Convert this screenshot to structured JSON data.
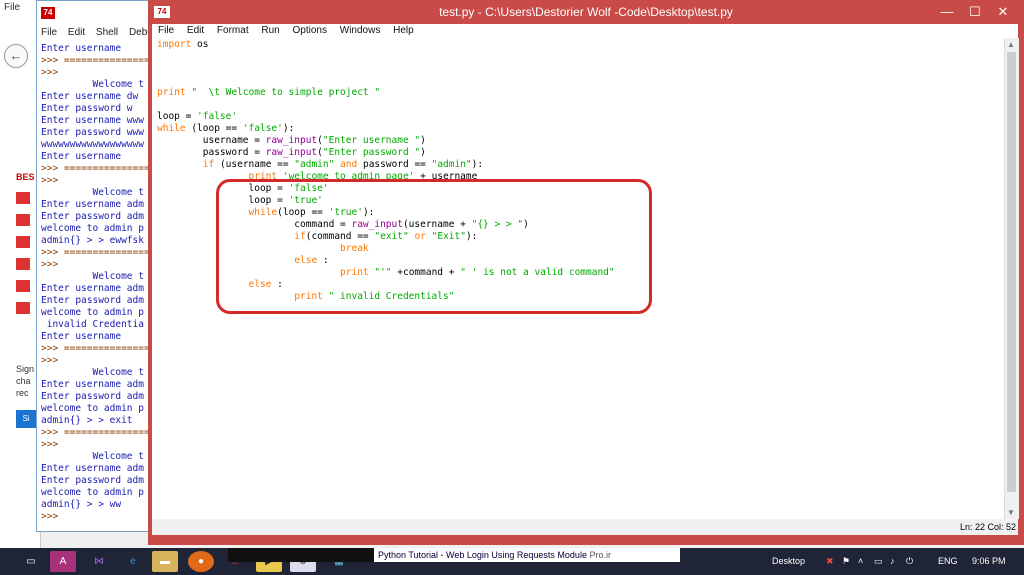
{
  "browser": {
    "menu_label": "File",
    "side_labels": [
      "BES",
      "Sign",
      "cha",
      "rec"
    ],
    "blue_button": "Si"
  },
  "shell": {
    "menu": [
      "File",
      "Edit",
      "Shell",
      "Debug"
    ],
    "lines": [
      {
        "t": "o",
        "text": "Enter username"
      },
      {
        "t": "p",
        "text": ">>> ================"
      },
      {
        "t": "p",
        "text": ">>>"
      },
      {
        "t": "o",
        "text": "         Welcome t"
      },
      {
        "t": "o",
        "text": "Enter username dw"
      },
      {
        "t": "o",
        "text": "Enter password w"
      },
      {
        "t": "o",
        "text": "Enter username www"
      },
      {
        "t": "o",
        "text": "Enter password www"
      },
      {
        "t": "o",
        "text": "wwwwwwwwwwwwwwwwww"
      },
      {
        "t": "o",
        "text": "Enter username"
      },
      {
        "t": "p",
        "text": ">>> ================"
      },
      {
        "t": "p",
        "text": ">>>"
      },
      {
        "t": "o",
        "text": "         Welcome t"
      },
      {
        "t": "o",
        "text": "Enter username adm"
      },
      {
        "t": "o",
        "text": "Enter password adm"
      },
      {
        "t": "o",
        "text": "welcome to admin p"
      },
      {
        "t": "o",
        "text": "admin{} > > ewwfsk"
      },
      {
        "t": "p",
        "text": ">>> ================"
      },
      {
        "t": "p",
        "text": ">>>"
      },
      {
        "t": "o",
        "text": "         Welcome t"
      },
      {
        "t": "o",
        "text": "Enter username adm"
      },
      {
        "t": "o",
        "text": "Enter password adm"
      },
      {
        "t": "o",
        "text": "welcome to admin p"
      },
      {
        "t": "o",
        "text": " invalid Credentia"
      },
      {
        "t": "o",
        "text": "Enter username"
      },
      {
        "t": "p",
        "text": ">>> ================"
      },
      {
        "t": "p",
        "text": ">>>"
      },
      {
        "t": "o",
        "text": "         Welcome t"
      },
      {
        "t": "o",
        "text": "Enter username adm"
      },
      {
        "t": "o",
        "text": "Enter password adm"
      },
      {
        "t": "o",
        "text": "welcome to admin p"
      },
      {
        "t": "o",
        "text": "admin{} > > exit"
      },
      {
        "t": "p",
        "text": ">>> ================"
      },
      {
        "t": "p",
        "text": ">>>"
      },
      {
        "t": "o",
        "text": "         Welcome t"
      },
      {
        "t": "o",
        "text": "Enter username adm"
      },
      {
        "t": "o",
        "text": "Enter password adm"
      },
      {
        "t": "o",
        "text": "welcome to admin p"
      },
      {
        "t": "o",
        "text": "admin{} > > ww"
      },
      {
        "t": "p",
        "text": ">>>"
      }
    ]
  },
  "editor": {
    "title": "test.py - C:\\Users\\Destorier Wolf -Code\\Desktop\\test.py",
    "menu": [
      "File",
      "Edit",
      "Format",
      "Run",
      "Options",
      "Windows",
      "Help"
    ],
    "status_position": "Ln: 22 Col: 52",
    "code": [
      [
        [
          "kw",
          "import"
        ],
        [
          "n",
          " os"
        ]
      ],
      [],
      [],
      [],
      [
        [
          "kw",
          "print"
        ],
        [
          "st",
          " \"  \\t Welcome to simple project \""
        ]
      ],
      [],
      [
        [
          "n",
          "loop = "
        ],
        [
          "st",
          "'false'"
        ]
      ],
      [
        [
          "kw",
          "while"
        ],
        [
          "n",
          " (loop == "
        ],
        [
          "st",
          "'false'"
        ],
        [
          "n",
          "):"
        ]
      ],
      [
        [
          "n",
          "        username = "
        ],
        [
          "bi",
          "raw_input"
        ],
        [
          "n",
          "("
        ],
        [
          "st",
          "\"Enter username \""
        ],
        [
          "n",
          ")"
        ]
      ],
      [
        [
          "n",
          "        password = "
        ],
        [
          "bi",
          "raw_input"
        ],
        [
          "n",
          "("
        ],
        [
          "st",
          "\"Enter password \""
        ],
        [
          "n",
          ")"
        ]
      ],
      [
        [
          "n",
          "        "
        ],
        [
          "kw",
          "if"
        ],
        [
          "n",
          " (username == "
        ],
        [
          "st",
          "\"admin\""
        ],
        [
          "n",
          " "
        ],
        [
          "kw",
          "and"
        ],
        [
          "n",
          " password == "
        ],
        [
          "st",
          "\"admin\""
        ],
        [
          "n",
          "):"
        ]
      ],
      [
        [
          "n",
          "                "
        ],
        [
          "kw",
          "print"
        ],
        [
          "st",
          " 'welcome to admin page'"
        ],
        [
          "n",
          " + username"
        ]
      ],
      [
        [
          "n",
          "                loop = "
        ],
        [
          "st",
          "'false'"
        ]
      ],
      [
        [
          "n",
          "                loop = "
        ],
        [
          "st",
          "'true'"
        ]
      ],
      [
        [
          "n",
          "                "
        ],
        [
          "kw",
          "while"
        ],
        [
          "n",
          "(loop == "
        ],
        [
          "st",
          "'true'"
        ],
        [
          "n",
          "):"
        ]
      ],
      [
        [
          "n",
          "                        command = "
        ],
        [
          "bi",
          "raw_input"
        ],
        [
          "n",
          "(username + "
        ],
        [
          "st",
          "\"{} > > \""
        ],
        [
          "n",
          ")"
        ]
      ],
      [
        [
          "n",
          "                        "
        ],
        [
          "kw",
          "if"
        ],
        [
          "n",
          "(command == "
        ],
        [
          "st",
          "\"exit\""
        ],
        [
          "n",
          " "
        ],
        [
          "kw",
          "or"
        ],
        [
          "n",
          " "
        ],
        [
          "st",
          "\"Exit\""
        ],
        [
          "n",
          "):"
        ]
      ],
      [
        [
          "n",
          "                                "
        ],
        [
          "kw",
          "break"
        ]
      ],
      [
        [
          "n",
          "                        "
        ],
        [
          "kw",
          "else"
        ],
        [
          "n",
          " :"
        ]
      ],
      [
        [
          "n",
          "                                "
        ],
        [
          "kw",
          "print"
        ],
        [
          "n",
          " "
        ],
        [
          "st",
          "\"'\""
        ],
        [
          "n",
          " +command + "
        ],
        [
          "st",
          "\" ' is not a valid command\""
        ]
      ],
      [
        [
          "n",
          "                "
        ],
        [
          "kw",
          "else"
        ],
        [
          "n",
          " :"
        ]
      ],
      [
        [
          "n",
          "                        "
        ],
        [
          "kw",
          "print"
        ],
        [
          "st",
          " \" invalid Credentials\""
        ]
      ]
    ]
  },
  "taskbar": {
    "preview_text": "Python Tutorial - Web Login Using Requests Module",
    "watermark": "Pro.ir",
    "desktop_label": "Desktop",
    "language": "ENG",
    "time": "9:06 PM",
    "colors": {
      "bg": "#1f2536",
      "accent": "#d42a2a"
    }
  }
}
